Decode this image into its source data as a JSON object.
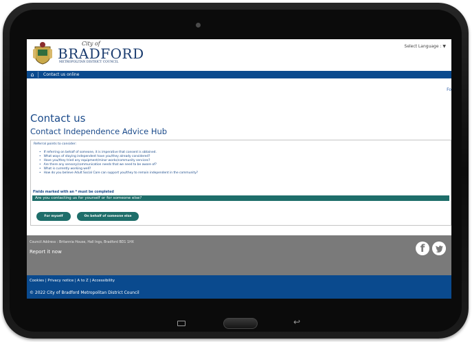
{
  "header": {
    "logo_city_of": "City of",
    "logo_name": "BRADFORD",
    "logo_council": "METROPOLITAN DISTRICT COUNCIL",
    "language": "Select Language : ▼"
  },
  "nav": {
    "home_icon": "house-icon",
    "link": "Contact us online",
    "corner": "Fo"
  },
  "main": {
    "title": "Contact us",
    "subtitle": "Contact Independence Advice Hub",
    "referral_title": "Referral points to consider:",
    "referral_points": [
      "If referring on behalf of someone, it is imperative that consent is obtained.",
      "What ways of staying independent have you/they already considered?",
      "Have you/they tried any equipment/minor works/community services?",
      "Are there any sensory/communication needs that we need to be aware of?",
      "What is currently working well?",
      "How do you believe Adult Social Care can support you/they to remain independent in the community?"
    ],
    "required_note": "Fields marked with an * must be completed",
    "question": "Are you contacting us for yourself or for someone else?",
    "button_self": "For myself",
    "button_other": "On behalf of someone else"
  },
  "footer": {
    "address": "Council Address : Britannia House, Hall Ings, Bradford BD1 1HX",
    "report": "Report it now",
    "facebook_icon": "f",
    "twitter_icon": "twitter-bird-icon",
    "links": "Cookies | Privacy notice | A to Z | Accessibility",
    "copyright": "© 2022 City of Bradford Metropolitan District Council"
  },
  "colors": {
    "nav_blue": "#0a4a8e",
    "teal": "#1e6e6a",
    "footer_grey": "#7a7a7a",
    "heading_blue": "#1a4a8a"
  }
}
